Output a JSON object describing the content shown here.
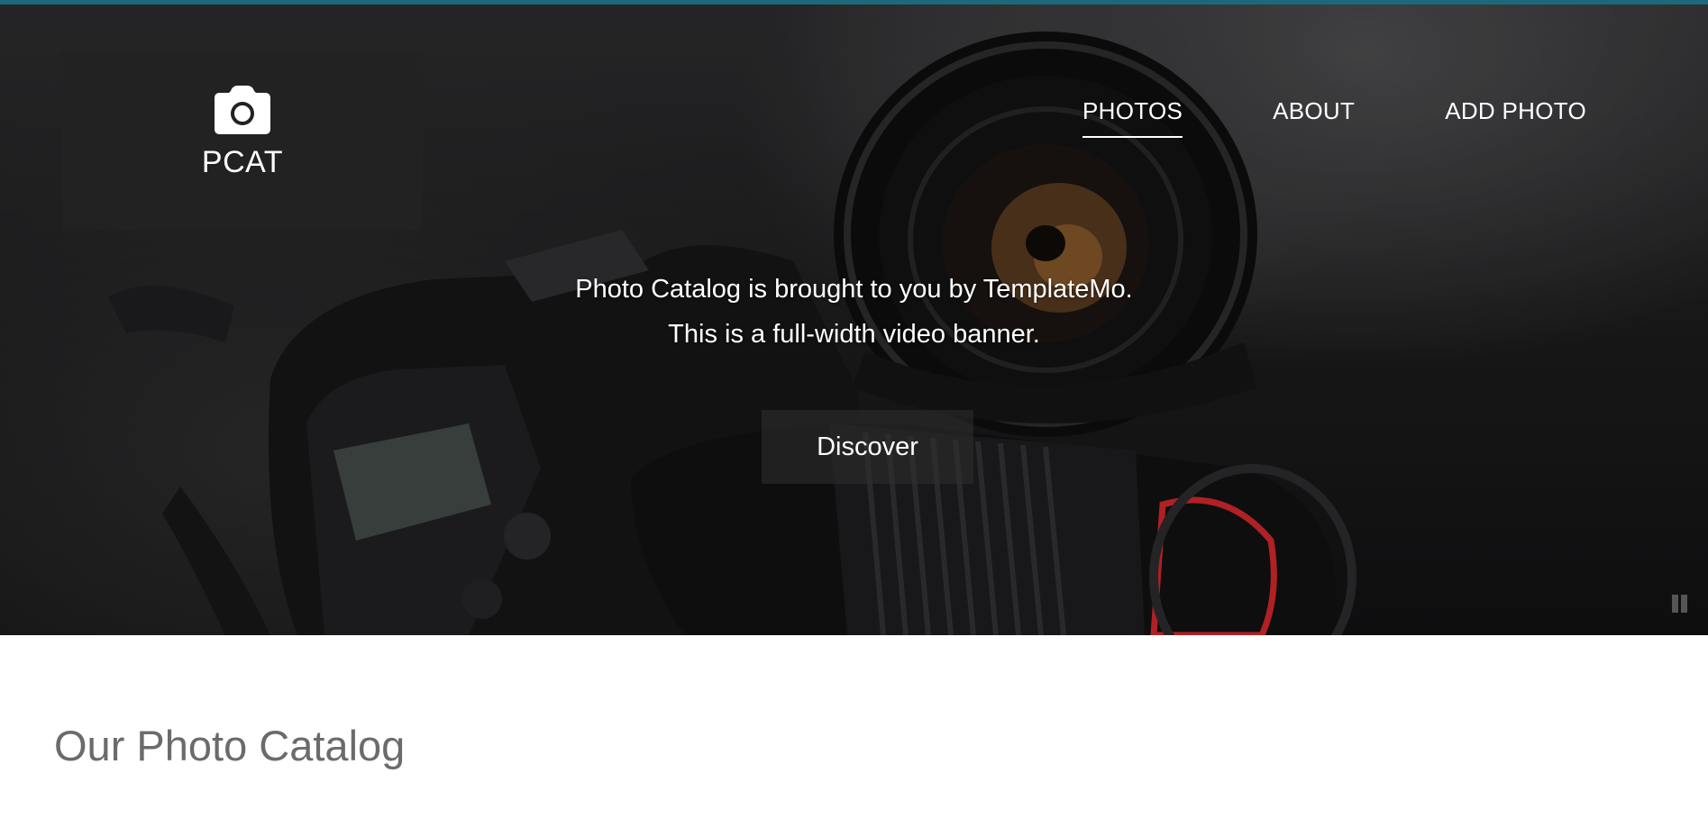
{
  "brand": {
    "name": "PCAT",
    "icon": "camera-icon"
  },
  "nav": {
    "items": [
      {
        "label": "PHOTOS",
        "active": true
      },
      {
        "label": "ABOUT",
        "active": false
      },
      {
        "label": "ADD PHOTO",
        "active": false
      }
    ]
  },
  "hero": {
    "line1": "Photo Catalog is brought to you by TemplateMo.",
    "line2": "This is a full-width video banner.",
    "button_label": "Discover",
    "pause_icon": "pause-icon"
  },
  "main": {
    "title": "Our Photo Catalog"
  },
  "colors": {
    "top_strip": "#1b6a7c",
    "brand_bg": "#222222",
    "title": "#6b6b6b"
  }
}
